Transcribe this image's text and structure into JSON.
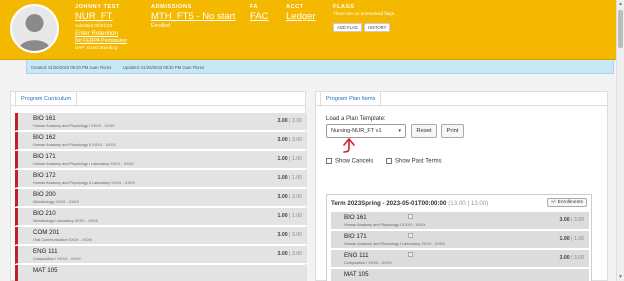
{
  "header": {
    "student_name": "JOHNNY TEST",
    "program_code": "NUR_FT",
    "admitted_date": "Admitted 05/01/23",
    "enter_retention": "Enter Retention",
    "no_ferpa": "No FERPA Permission",
    "sap_status": "SAP: Good Standing",
    "admissions_label": "ADMISSIONS",
    "admissions_link": "MTH_FT5 - No start",
    "enrolled": "Enrolled",
    "fa_label": "FA",
    "fa_link": "FAC",
    "acct_label": "ACCT",
    "acct_link": "Ledger",
    "flags_label": "FLAGS",
    "flags_note": "There are no unresolved flags.",
    "add_flag": "ADD FLAG",
    "history": "HISTORY"
  },
  "info_strip": {
    "created": "Created: 01/26/2023 09:20 PM Juan Flores",
    "updated": "Updated: 01/26/2023 09:20 PM Juan Flores"
  },
  "curriculum": {
    "tab_label": "Program Curriculum",
    "courses": [
      {
        "code": "BIO 161",
        "desc": "Human Anatomy and Physiology I    XXXX - XXXX",
        "credits": "3.00",
        "max": "3.00"
      },
      {
        "code": "BIO 162",
        "desc": "Human Anatomy and Physiology II    XXXX - XXXX",
        "credits": "3.00",
        "max": "3.00"
      },
      {
        "code": "BIO 171",
        "desc": "Human Anatomy and Physiology I Laboratory    XXXX - XXXX",
        "credits": "1.00",
        "max": "1.00"
      },
      {
        "code": "BIO 172",
        "desc": "Human Anatomy and Physiology II Laboratory    XXXX - XXXX",
        "credits": "1.00",
        "max": "1.00"
      },
      {
        "code": "BIO 200",
        "desc": "Microbiology    XXXX - XXXX",
        "credits": "3.00",
        "max": "3.00"
      },
      {
        "code": "BIO 210",
        "desc": "Microbiology Laboratory    XXXX - XXXX",
        "credits": "1.00",
        "max": "1.00"
      },
      {
        "code": "COM 201",
        "desc": "Oral Communication    XXXX - XXXX",
        "credits": "3.00",
        "max": "3.00"
      },
      {
        "code": "ENG 111",
        "desc": "Composition I    XXXX - XXXX",
        "credits": "3.00",
        "max": "3.00"
      },
      {
        "code": "MAT 105",
        "desc": "",
        "credits": "",
        "max": ""
      }
    ]
  },
  "plan": {
    "tab_label": "Program Plan Items",
    "template_label": "Load a Plan Template:",
    "template_value": "Nursing-NUR_FT v1",
    "reset": "Reset",
    "print": "Print",
    "show_cancels": "Show Cancels",
    "show_past_terms": "Show Past Terms",
    "term_title": "Term 2023Spring - 2023-05-01T00:00:00",
    "term_credits": "(13.00 | 13.00)",
    "enrollments": "+/- Enrollments",
    "term_courses": [
      {
        "code": "BIO 161",
        "desc": "Human Anatomy and Physiology I    XXXX - XXXX",
        "credits": "3.00",
        "max": "3.00"
      },
      {
        "code": "BIO 171",
        "desc": "Human Anatomy and Physiology I Laboratory    XXXX - XXXX",
        "credits": "1.00",
        "max": "1.00"
      },
      {
        "code": "ENG 111",
        "desc": "Composition I    XXXX - XXXX",
        "credits": "3.00",
        "max": "3.00"
      },
      {
        "code": "MAT 105",
        "desc": "",
        "credits": "",
        "max": ""
      }
    ]
  },
  "colors": {
    "header_bg": "#f5b800",
    "info_bg": "#c6e9f5",
    "accent_red": "#c0202e",
    "link_blue": "#2a6fb5"
  }
}
